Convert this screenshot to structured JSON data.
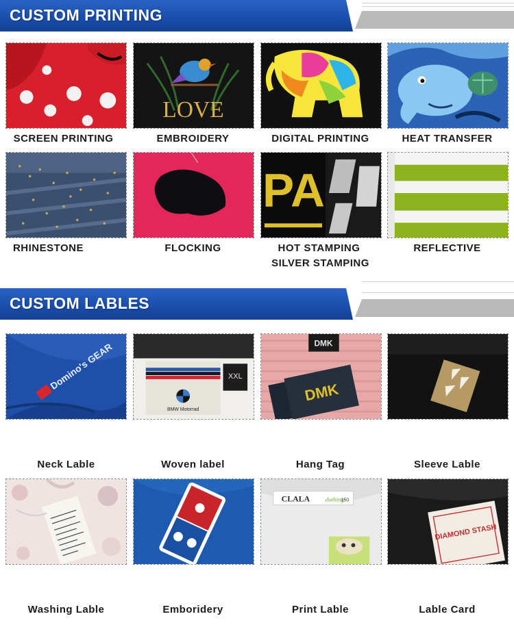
{
  "printing": {
    "title": "CUSTOM PRINTING",
    "items": [
      {
        "label": "SCREEN PRINTING"
      },
      {
        "label": "EMBROIDERY",
        "image_text": "LOVE"
      },
      {
        "label": "DIGITAL PRINTING"
      },
      {
        "label": "HEAT TRANSFER"
      },
      {
        "label": "RHINESTONE"
      },
      {
        "label": "FLOCKING"
      },
      {
        "label": "HOT STAMPING",
        "label2": "SILVER  STAMPING",
        "image_text": "PA"
      },
      {
        "label": "REFLECTIVE"
      }
    ]
  },
  "labels": {
    "title": "CUSTOM LABLES",
    "items": [
      {
        "label": "Neck Lable",
        "image_text": "Domino's GEAR"
      },
      {
        "label": "Woven label",
        "image_text": "BMW Motorrad",
        "size_text": "XXL"
      },
      {
        "label": "Hang Tag",
        "image_text": "DMK"
      },
      {
        "label": "Sleeve Lable"
      },
      {
        "label": "Washing Lable"
      },
      {
        "label": "Emboridery"
      },
      {
        "label": "Print Lable",
        "image_text": "CLALA",
        "size_text": "150"
      },
      {
        "label": "Lable Card",
        "image_text": "DIAMOND STASH"
      }
    ]
  }
}
